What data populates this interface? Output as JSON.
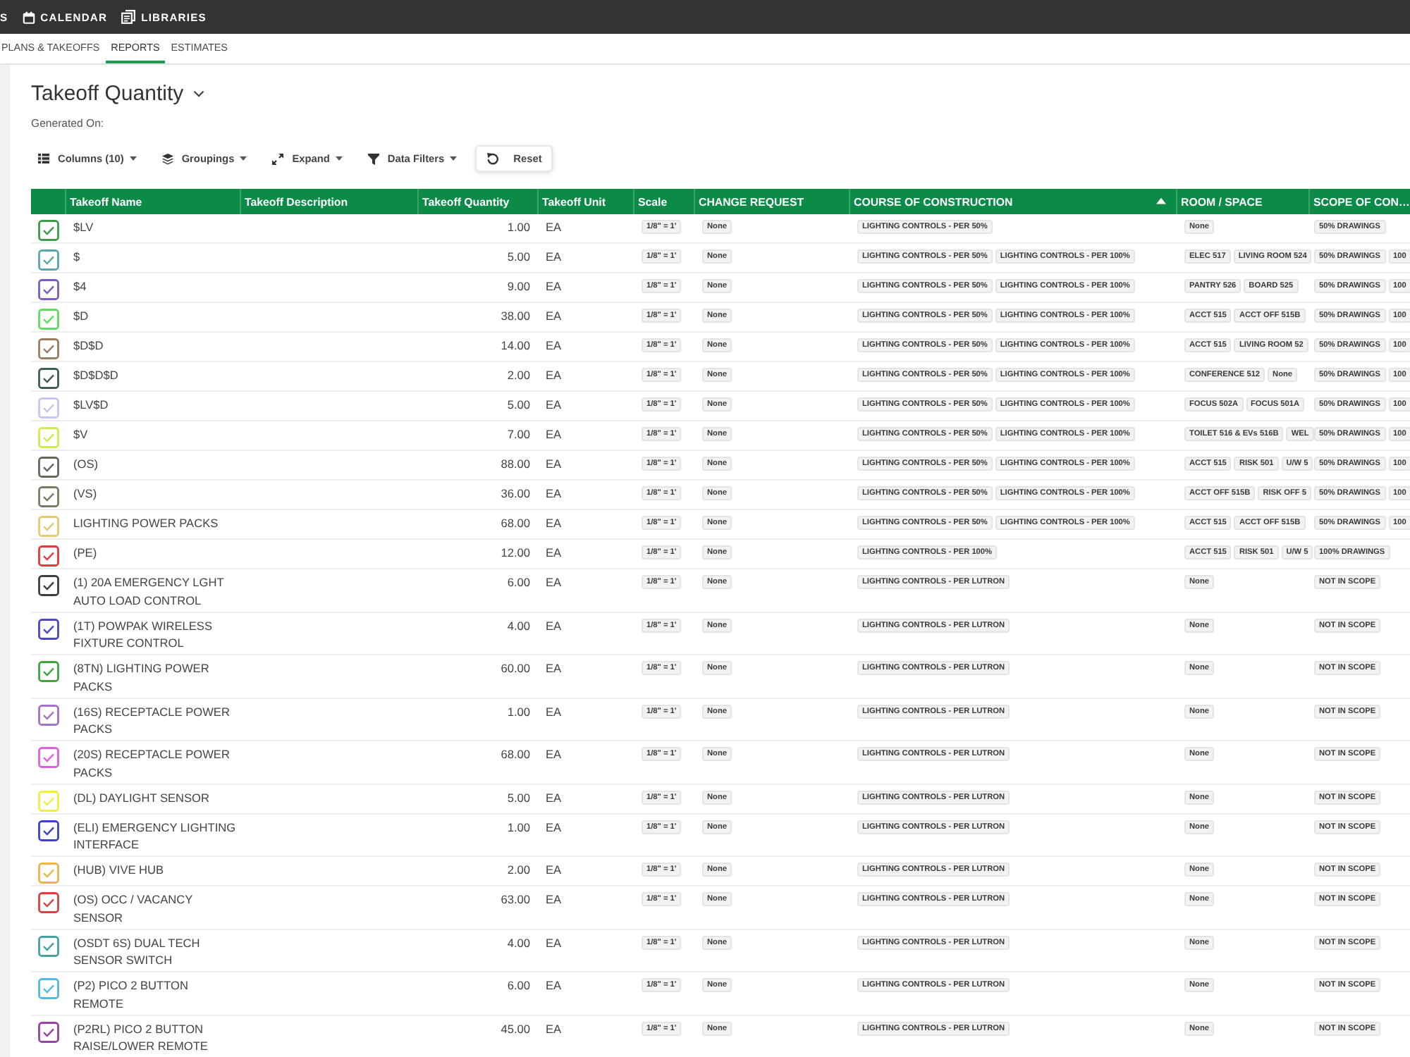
{
  "top_nav": {
    "items": [
      {
        "label": "S"
      },
      {
        "label": "CALENDAR"
      },
      {
        "label": "LIBRARIES"
      }
    ]
  },
  "sub_tabs": [
    {
      "label": "PLANS & TAKEOFFS",
      "selected": false
    },
    {
      "label": "REPORTS",
      "selected": true
    },
    {
      "label": "ESTIMATES",
      "selected": false
    }
  ],
  "report": {
    "title": "Takeoff Quantity",
    "generated_label": "Generated On:"
  },
  "toolbar": [
    {
      "label": "Columns (10)",
      "kind": "dropdown"
    },
    {
      "label": "Groupings",
      "kind": "dropdown"
    },
    {
      "label": "Expand",
      "kind": "dropdown"
    },
    {
      "label": "Data Filters",
      "kind": "dropdown"
    },
    {
      "label": "Reset",
      "kind": "button"
    }
  ],
  "table": {
    "columns": [
      {
        "label": "Takeoff Name",
        "sorted": false
      },
      {
        "label": "Takeoff Description",
        "sorted": false
      },
      {
        "label": "Takeoff Quantity",
        "sorted": false
      },
      {
        "label": "Takeoff Unit",
        "sorted": false
      },
      {
        "label": "Scale",
        "sorted": false
      },
      {
        "label": "CHANGE REQUEST",
        "sorted": false
      },
      {
        "label": "COURSE OF CONSTRUCTION",
        "sorted": true
      },
      {
        "label": "ROOM / SPACE",
        "sorted": false
      },
      {
        "label": "SCOPE OF CON…",
        "sorted": false
      }
    ],
    "rows": [
      {
        "checked": true,
        "color": "#3c9c4c",
        "name": "$LV",
        "quantity": "1.00",
        "unit": "EA",
        "scale": "1/8\" = 1'",
        "change_request": "None",
        "course": [
          "LIGHTING CONTROLS - PER 50%"
        ],
        "room": [
          "None"
        ],
        "scope": [
          "50% DRAWINGS"
        ]
      },
      {
        "checked": true,
        "color": "#5ba6aa",
        "name": "$",
        "quantity": "5.00",
        "unit": "EA",
        "scale": "1/8\" = 1'",
        "change_request": "None",
        "course": [
          "LIGHTING CONTROLS - PER 50%",
          "LIGHTING CONTROLS - PER 100%"
        ],
        "room": [
          "ELEC 517",
          "LIVING ROOM 524"
        ],
        "scope": [
          "50% DRAWINGS",
          "100"
        ]
      },
      {
        "checked": true,
        "color": "#7a5cc2",
        "name": "$4",
        "quantity": "9.00",
        "unit": "EA",
        "scale": "1/8\" = 1'",
        "change_request": "None",
        "course": [
          "LIGHTING CONTROLS - PER 50%",
          "LIGHTING CONTROLS - PER 100%"
        ],
        "room": [
          "PANTRY 526",
          "BOARD 525"
        ],
        "scope": [
          "50% DRAWINGS",
          "100"
        ]
      },
      {
        "checked": true,
        "color": "#5fdc5f",
        "name": "$D",
        "quantity": "38.00",
        "unit": "EA",
        "scale": "1/8\" = 1'",
        "change_request": "None",
        "course": [
          "LIGHTING CONTROLS - PER 50%",
          "LIGHTING CONTROLS - PER 100%"
        ],
        "room": [
          "ACCT 515",
          "ACCT OFF 515B"
        ],
        "scope": [
          "50% DRAWINGS",
          "100"
        ]
      },
      {
        "checked": true,
        "color": "#9a7c64",
        "name": "$D$D",
        "quantity": "14.00",
        "unit": "EA",
        "scale": "1/8\" = 1'",
        "change_request": "None",
        "course": [
          "LIGHTING CONTROLS - PER 50%",
          "LIGHTING CONTROLS - PER 100%"
        ],
        "room": [
          "ACCT 515",
          "LIVING ROOM 52"
        ],
        "scope": [
          "50% DRAWINGS",
          "100"
        ]
      },
      {
        "checked": true,
        "color": "#3f5c58",
        "name": "$D$D$D",
        "quantity": "2.00",
        "unit": "EA",
        "scale": "1/8\" = 1'",
        "change_request": "None",
        "course": [
          "LIGHTING CONTROLS - PER 50%",
          "LIGHTING CONTROLS - PER 100%"
        ],
        "room": [
          "CONFERENCE 512",
          "None"
        ],
        "scope": [
          "50% DRAWINGS",
          "100"
        ]
      },
      {
        "checked": true,
        "color": "#c4c6f0",
        "name": "$LV$D",
        "quantity": "5.00",
        "unit": "EA",
        "scale": "1/8\" = 1'",
        "change_request": "None",
        "course": [
          "LIGHTING CONTROLS - PER 50%",
          "LIGHTING CONTROLS - PER 100%"
        ],
        "room": [
          "FOCUS 502A",
          "FOCUS 501A"
        ],
        "scope": [
          "50% DRAWINGS",
          "100"
        ]
      },
      {
        "checked": true,
        "color": "#d4e84c",
        "name": "$V",
        "quantity": "7.00",
        "unit": "EA",
        "scale": "1/8\" = 1'",
        "change_request": "None",
        "course": [
          "LIGHTING CONTROLS - PER 50%",
          "LIGHTING CONTROLS - PER 100%"
        ],
        "room": [
          "TOILET 516 & EVs 516B",
          "WEL"
        ],
        "scope": [
          "50% DRAWINGS",
          "100"
        ]
      },
      {
        "checked": true,
        "color": "#66685a",
        "name": "(OS)",
        "quantity": "88.00",
        "unit": "EA",
        "scale": "1/8\" = 1'",
        "change_request": "None",
        "course": [
          "LIGHTING CONTROLS - PER 50%",
          "LIGHTING CONTROLS - PER 100%"
        ],
        "room": [
          "ACCT 515",
          "RISK 501",
          "U/W 5"
        ],
        "scope": [
          "50% DRAWINGS",
          "100"
        ]
      },
      {
        "checked": true,
        "color": "#7e7866",
        "name": "(VS)",
        "quantity": "36.00",
        "unit": "EA",
        "scale": "1/8\" = 1'",
        "change_request": "None",
        "course": [
          "LIGHTING CONTROLS - PER 50%",
          "LIGHTING CONTROLS - PER 100%"
        ],
        "room": [
          "ACCT OFF 515B",
          "RISK OFF 5"
        ],
        "scope": [
          "50% DRAWINGS",
          "100"
        ]
      },
      {
        "checked": true,
        "color": "#e6c872",
        "name": "LIGHTING POWER PACKS",
        "quantity": "68.00",
        "unit": "EA",
        "scale": "1/8\" = 1'",
        "change_request": "None",
        "course": [
          "LIGHTING CONTROLS - PER 50%",
          "LIGHTING CONTROLS - PER 100%"
        ],
        "room": [
          "ACCT 515",
          "ACCT OFF 515B"
        ],
        "scope": [
          "50% DRAWINGS",
          "100"
        ]
      },
      {
        "checked": true,
        "color": "#e03a3a",
        "name": "(PE)",
        "quantity": "12.00",
        "unit": "EA",
        "scale": "1/8\" = 1'",
        "change_request": "None",
        "course": [
          "LIGHTING CONTROLS - PER 100%"
        ],
        "room": [
          "ACCT 515",
          "RISK 501",
          "U/W 5"
        ],
        "scope": [
          "100% DRAWINGS"
        ]
      },
      {
        "checked": true,
        "color": "#3e3e3e",
        "name": "(1) 20A EMERGENCY LGHT AUTO LOAD CONTROL",
        "quantity": "6.00",
        "unit": "EA",
        "scale": "1/8\" = 1'",
        "change_request": "None",
        "course": [
          "LIGHTING CONTROLS - PER LUTRON"
        ],
        "room": [
          "None"
        ],
        "scope": [
          "NOT IN SCOPE"
        ]
      },
      {
        "checked": true,
        "color": "#4a48c8",
        "name": "(1T) POWPAK WIRELESS FIXTURE CONTROL",
        "quantity": "4.00",
        "unit": "EA",
        "scale": "1/8\" = 1'",
        "change_request": "None",
        "course": [
          "LIGHTING CONTROLS - PER LUTRON"
        ],
        "room": [
          "None"
        ],
        "scope": [
          "NOT IN SCOPE"
        ]
      },
      {
        "checked": true,
        "color": "#3ea43e",
        "name": "(8TN) LIGHTING POWER PACKS",
        "quantity": "60.00",
        "unit": "EA",
        "scale": "1/8\" = 1'",
        "change_request": "None",
        "course": [
          "LIGHTING CONTROLS - PER LUTRON"
        ],
        "room": [
          "None"
        ],
        "scope": [
          "NOT IN SCOPE"
        ]
      },
      {
        "checked": true,
        "color": "#a272c8",
        "name": "(16S) RECEPTACLE POWER PACKS",
        "quantity": "1.00",
        "unit": "EA",
        "scale": "1/8\" = 1'",
        "change_request": "None",
        "course": [
          "LIGHTING CONTROLS - PER LUTRON"
        ],
        "room": [
          "None"
        ],
        "scope": [
          "NOT IN SCOPE"
        ]
      },
      {
        "checked": true,
        "color": "#e05ee0",
        "name": "(20S) RECEPTACLE POWER PACKS",
        "quantity": "68.00",
        "unit": "EA",
        "scale": "1/8\" = 1'",
        "change_request": "None",
        "course": [
          "LIGHTING CONTROLS - PER LUTRON"
        ],
        "room": [
          "None"
        ],
        "scope": [
          "NOT IN SCOPE"
        ]
      },
      {
        "checked": true,
        "color": "#eeee44",
        "name": "(DL) DAYLIGHT SENSOR",
        "quantity": "5.00",
        "unit": "EA",
        "scale": "1/8\" = 1'",
        "change_request": "None",
        "course": [
          "LIGHTING CONTROLS - PER LUTRON"
        ],
        "room": [
          "None"
        ],
        "scope": [
          "NOT IN SCOPE"
        ]
      },
      {
        "checked": true,
        "color": "#3e40cc",
        "name": "(ELI) EMERGENCY LIGHTING INTERFACE",
        "quantity": "1.00",
        "unit": "EA",
        "scale": "1/8\" = 1'",
        "change_request": "None",
        "course": [
          "LIGHTING CONTROLS - PER LUTRON"
        ],
        "room": [
          "None"
        ],
        "scope": [
          "NOT IN SCOPE"
        ]
      },
      {
        "checked": true,
        "color": "#f0b444",
        "name": "(HUB) VIVE HUB",
        "quantity": "2.00",
        "unit": "EA",
        "scale": "1/8\" = 1'",
        "change_request": "None",
        "course": [
          "LIGHTING CONTROLS - PER LUTRON"
        ],
        "room": [
          "None"
        ],
        "scope": [
          "NOT IN SCOPE"
        ]
      },
      {
        "checked": true,
        "color": "#d84242",
        "name": "(OS) OCC / VACANCY SENSOR",
        "quantity": "63.00",
        "unit": "EA",
        "scale": "1/8\" = 1'",
        "change_request": "None",
        "course": [
          "LIGHTING CONTROLS - PER LUTRON"
        ],
        "room": [
          "None"
        ],
        "scope": [
          "NOT IN SCOPE"
        ]
      },
      {
        "checked": true,
        "color": "#44a2a2",
        "name": "(OSDT 6S) DUAL TECH SENSOR SWITCH",
        "quantity": "4.00",
        "unit": "EA",
        "scale": "1/8\" = 1'",
        "change_request": "None",
        "course": [
          "LIGHTING CONTROLS - PER LUTRON"
        ],
        "room": [
          "None"
        ],
        "scope": [
          "NOT IN SCOPE"
        ]
      },
      {
        "checked": true,
        "color": "#52b8e0",
        "name": "(P2) PICO 2 BUTTON REMOTE",
        "quantity": "6.00",
        "unit": "EA",
        "scale": "1/8\" = 1'",
        "change_request": "None",
        "course": [
          "LIGHTING CONTROLS - PER LUTRON"
        ],
        "room": [
          "None"
        ],
        "scope": [
          "NOT IN SCOPE"
        ]
      },
      {
        "checked": true,
        "color": "#9444a4",
        "name": "(P2RL) PICO 2 BUTTON RAISE/LOWER REMOTE",
        "quantity": "45.00",
        "unit": "EA",
        "scale": "1/8\" = 1'",
        "change_request": "None",
        "course": [
          "LIGHTING CONTROLS - PER LUTRON"
        ],
        "room": [
          "None"
        ],
        "scope": [
          "NOT IN SCOPE"
        ]
      }
    ]
  }
}
